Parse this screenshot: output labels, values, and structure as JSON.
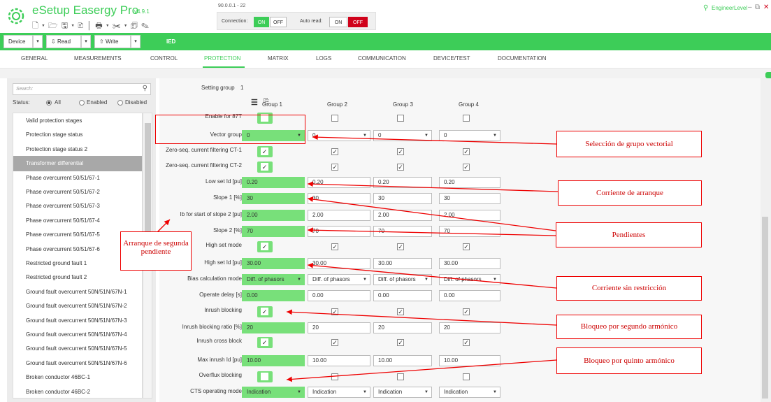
{
  "app": {
    "name": "eSetup Easergy Pro",
    "version": "v4.9.1",
    "ip": "90.0.0.1 - 22",
    "user": "EngineerLevel",
    "qa_icons": "🗋 ▾ 🗁 🖫 ▾ 🗈 │ 🖶 ▾ ✂ ▾ 🗊 ✎"
  },
  "connection": {
    "label": "Connection:",
    "on": "ON",
    "off": "OFF",
    "auto_label": "Auto read:",
    "auto_on": "ON",
    "auto_off": "OFF"
  },
  "toolbar": {
    "device": "Device",
    "read": "Read",
    "write": "Write",
    "ied": "IED"
  },
  "tabs": [
    "GENERAL",
    "MEASUREMENTS",
    "CONTROL",
    "PROTECTION",
    "MATRIX",
    "LOGS",
    "COMMUNICATION",
    "DEVICE/TEST",
    "DOCUMENTATION"
  ],
  "sidebar": {
    "search_placeholder": "Search:",
    "status_label": "Status:",
    "opt_all": "All",
    "opt_enabled": "Enabled",
    "opt_disabled": "Disabled",
    "items": [
      "Valid protection stages",
      "Protection stage status",
      "Protection stage status 2",
      "Transformer differential",
      "Phase overcurrent 50/51/67-1",
      "Phase overcurrent 50/51/67-2",
      "Phase overcurrent 50/51/67-3",
      "Phase overcurrent 50/51/67-4",
      "Phase overcurrent 50/51/67-5",
      "Phase overcurrent 50/51/67-6",
      "Restricted ground fault 1",
      "Restricted ground fault 2",
      "Ground fault overcurrent 50N/51N/67N-1",
      "Ground fault overcurrent 50N/51N/67N-2",
      "Ground fault overcurrent 50N/51N/67N-3",
      "Ground fault overcurrent 50N/51N/67N-4",
      "Ground fault overcurrent 50N/51N/67N-5",
      "Ground fault overcurrent 50N/51N/67N-6",
      "Broken conductor 46BC-1",
      "Broken conductor 46BC-2"
    ]
  },
  "settings": {
    "group_label": "Setting group",
    "group_value": "1",
    "headers": [
      "Group 1",
      "Group 2",
      "Group 3",
      "Group 4"
    ],
    "rows": [
      {
        "label": "Enable for 87T",
        "type": "check",
        "values": [
          "",
          "",
          "",
          ""
        ]
      },
      {
        "label": "Vector group",
        "type": "dd",
        "values": [
          "0",
          "0",
          "0",
          "0"
        ]
      },
      {
        "label": "Zero-seq. current filtering CT-1",
        "type": "check",
        "values": [
          "✓",
          "✓",
          "✓",
          "✓"
        ]
      },
      {
        "label": "Zero-seq. current filtering CT-2",
        "type": "check",
        "values": [
          "✓",
          "✓",
          "✓",
          "✓"
        ]
      },
      {
        "label": "Low set Id [pu]",
        "type": "num",
        "values": [
          "0.20",
          "0.20",
          "0.20",
          "0.20"
        ]
      },
      {
        "label": "Slope 1 [%]",
        "type": "num",
        "values": [
          "30",
          "30",
          "30",
          "30"
        ]
      },
      {
        "label": "Ib for start of slope 2 [pu]",
        "type": "num",
        "values": [
          "2.00",
          "2.00",
          "2.00",
          "2.00"
        ]
      },
      {
        "label": "Slope 2 [%]",
        "type": "num",
        "values": [
          "70",
          "70",
          "70",
          "70"
        ]
      },
      {
        "label": "High set mode",
        "type": "check",
        "values": [
          "✓",
          "✓",
          "✓",
          "✓"
        ]
      },
      {
        "label": "High set Id [pu]",
        "type": "num",
        "values": [
          "30.00",
          "30.00",
          "30.00",
          "30.00"
        ]
      },
      {
        "label": "Bias calculation mode",
        "type": "dd",
        "values": [
          "Diff. of phasors",
          "Diff. of phasors",
          "Diff. of phasors",
          "Diff. of phasors"
        ]
      },
      {
        "label": "Operate delay [s]",
        "type": "num",
        "values": [
          "0.00",
          "0.00",
          "0.00",
          "0.00"
        ]
      },
      {
        "label": "Inrush blocking",
        "type": "check",
        "values": [
          "✓",
          "✓",
          "✓",
          "✓"
        ]
      },
      {
        "label": "Inrush blocking ratio [%]",
        "type": "num",
        "values": [
          "20",
          "20",
          "20",
          "20"
        ]
      },
      {
        "label": "Inrush cross block",
        "type": "check",
        "values": [
          "✓",
          "✓",
          "✓",
          "✓"
        ]
      },
      {
        "label": "Max inrush Id [pu]",
        "type": "num",
        "values": [
          "10.00",
          "10.00",
          "10.00",
          "10.00"
        ]
      },
      {
        "label": "Overflux blocking",
        "type": "check",
        "values": [
          "",
          "",
          "",
          ""
        ]
      },
      {
        "label": "CTS operating mode",
        "type": "dd",
        "values": [
          "Indication",
          "Indication",
          "Indication",
          "Indication"
        ]
      }
    ]
  },
  "annotations": {
    "vector": "Selección de grupo vectorial",
    "arranque": "Corriente de arranque",
    "pendientes": "Pendientes",
    "sinrestr": "Corriente sin restricción",
    "segundo": "Bloqueo por segundo armónico",
    "quinto": "Bloqueo por quinto armónico",
    "segunda_pend": "Arranque de segunda pendiente"
  },
  "colors": {
    "brand": "#3dcd58",
    "highlight": "#78e07a",
    "annotation": "#e00000"
  }
}
